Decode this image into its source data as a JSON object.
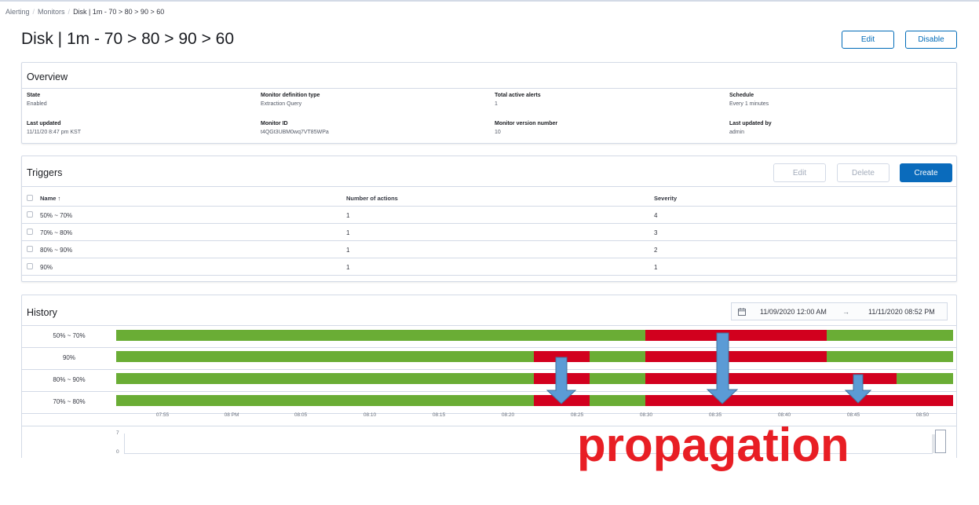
{
  "breadcrumbs": [
    "Alerting",
    "Monitors",
    "Disk | 1m - 70 > 80 > 90 > 60"
  ],
  "page_title": "Disk | 1m - 70 > 80 > 90 > 60",
  "header_buttons": {
    "edit": "Edit",
    "disable": "Disable"
  },
  "overview": {
    "title": "Overview",
    "items": [
      {
        "label": "State",
        "value": "Enabled"
      },
      {
        "label": "Monitor definition type",
        "value": "Extraction Query"
      },
      {
        "label": "Total active alerts",
        "value": "1"
      },
      {
        "label": "Schedule",
        "value": "Every 1 minutes"
      },
      {
        "label": "Last updated",
        "value": "11/11/20 8:47 pm KST"
      },
      {
        "label": "Monitor ID",
        "value": "t4QGt3UBM0wq7VT85WPa"
      },
      {
        "label": "Monitor version number",
        "value": "10"
      },
      {
        "label": "Last updated by",
        "value": "admin"
      }
    ]
  },
  "triggers": {
    "title": "Triggers",
    "buttons": {
      "edit": "Edit",
      "delete": "Delete",
      "create": "Create"
    },
    "columns": [
      "Name ↑",
      "Number of actions",
      "Severity"
    ],
    "rows": [
      {
        "name": "50% ~ 70%",
        "actions": "1",
        "severity": "4"
      },
      {
        "name": "70% ~ 80%",
        "actions": "1",
        "severity": "3"
      },
      {
        "name": "80% ~ 90%",
        "actions": "1",
        "severity": "2"
      },
      {
        "name": "90%",
        "actions": "1",
        "severity": "1"
      }
    ]
  },
  "history": {
    "title": "History",
    "date_start": "11/09/2020 12:00 AM",
    "date_arrow": "→",
    "date_end": "11/11/2020 08:52 PM",
    "tracks": [
      "50% ~ 70%",
      "90%",
      "80% ~ 90%",
      "70% ~ 80%"
    ],
    "ticks": [
      "07:55",
      "08 PM",
      "08:05",
      "08:10",
      "08:15",
      "08:20",
      "08:25",
      "08:30",
      "08:35",
      "08:40",
      "08:45",
      "08:50"
    ],
    "count_axis": [
      "7",
      "0"
    ],
    "colors": {
      "ok": "#6aad35",
      "alert": "#d2001e"
    }
  },
  "annotation": {
    "text": "propagation",
    "color": "#e81e24",
    "arrow_color": "#5b9bd5"
  }
}
